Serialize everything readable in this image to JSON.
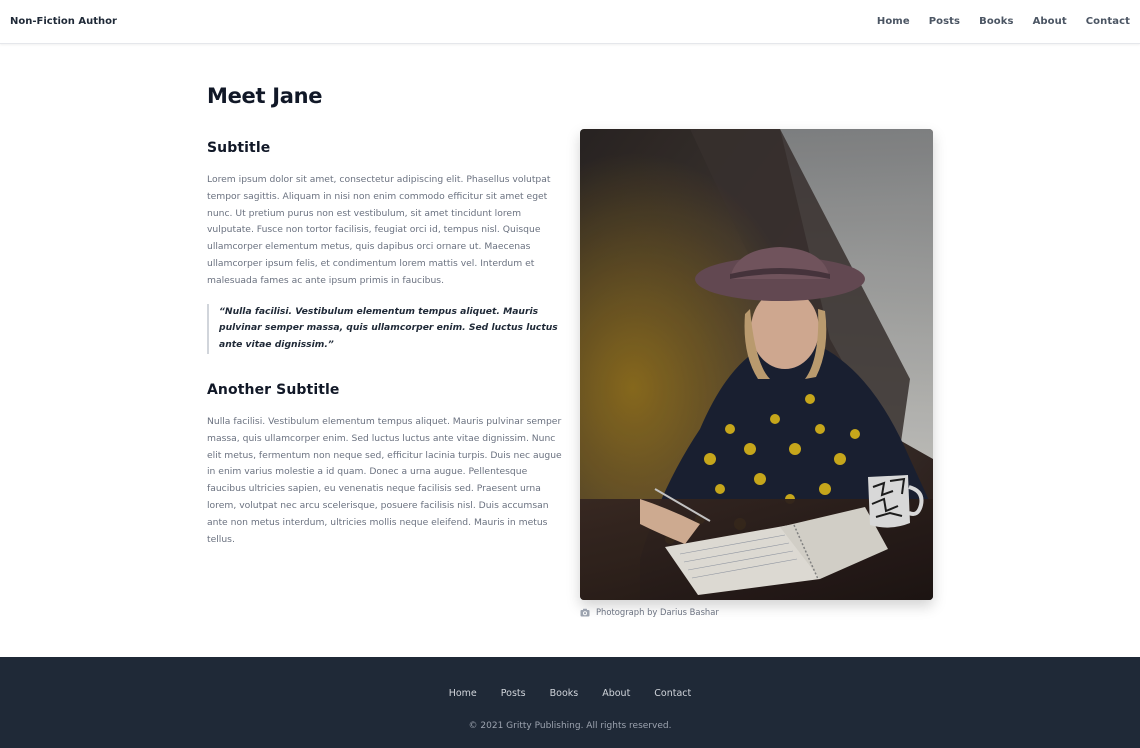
{
  "header": {
    "brand": "Non-Fiction Author",
    "nav": [
      "Home",
      "Posts",
      "Books",
      "About",
      "Contact"
    ]
  },
  "page": {
    "title": "Meet Jane"
  },
  "content": {
    "subtitle1": "Subtitle",
    "paragraph1": "Lorem ipsum dolor sit amet, consectetur adipiscing elit. Phasellus volutpat tempor sagittis. Aliquam in nisi non enim commodo efficitur sit amet eget nunc. Ut pretium purus non est vestibulum, sit amet tincidunt lorem vulputate. Fusce non tortor facilisis, feugiat orci id, tempus nisl. Quisque ullamcorper elementum metus, quis dapibus orci ornare ut. Maecenas ullamcorper ipsum felis, et condimentum lorem mattis vel. Interdum et malesuada fames ac ante ipsum primis in faucibus.",
    "quote": "“Nulla facilisi. Vestibulum elementum tempus aliquet. Mauris pulvinar semper massa, quis ullamcorper enim. Sed luctus luctus ante vitae dignissim.”",
    "subtitle2": "Another Subtitle",
    "paragraph2": "Nulla facilisi. Vestibulum elementum tempus aliquet. Mauris pulvinar semper massa, quis ullamcorper enim. Sed luctus luctus ante vitae dignissim. Nunc elit metus, fermentum non neque sed, efficitur lacinia turpis. Duis nec augue in enim varius molestie a id quam. Donec a urna augue. Pellentesque faucibus ultricies sapien, eu venenatis neque facilisis sed. Praesent urna lorem, volutpat nec arcu scelerisque, posuere facilisis nisl. Duis accumsan ante non metus interdum, ultricies mollis neque eleifend. Mauris in metus tellus."
  },
  "photo": {
    "caption": "Photograph by Darius Bashar",
    "caption_icon": "camera-icon"
  },
  "footer": {
    "nav": [
      "Home",
      "Posts",
      "Books",
      "About",
      "Contact"
    ],
    "copyright": "© 2021 Gritty Publishing. All rights reserved."
  },
  "colors": {
    "footer_bg": "#1f2937",
    "heading": "#111827",
    "body_text": "#6b7280"
  }
}
